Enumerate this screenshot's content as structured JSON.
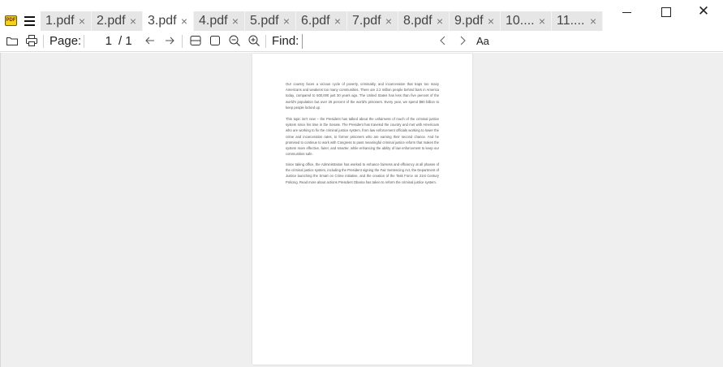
{
  "app": {
    "icon_text": "PDF"
  },
  "tabs": [
    {
      "label": "1.pdf",
      "close": "×",
      "active": false
    },
    {
      "label": "2.pdf",
      "close": "×",
      "active": false
    },
    {
      "label": "3.pdf",
      "close": "×",
      "active": true
    },
    {
      "label": "4.pdf",
      "close": "×",
      "active": false
    },
    {
      "label": "5.pdf",
      "close": "×",
      "active": false
    },
    {
      "label": "6.pdf",
      "close": "×",
      "active": false
    },
    {
      "label": "7.pdf",
      "close": "×",
      "active": false
    },
    {
      "label": "8.pdf",
      "close": "×",
      "active": false
    },
    {
      "label": "9.pdf",
      "close": "×",
      "active": false
    },
    {
      "label": "10....",
      "close": "×",
      "active": false
    },
    {
      "label": "11....",
      "close": "×",
      "active": false
    }
  ],
  "window": {
    "close_glyph": "✕"
  },
  "toolbar": {
    "page_label": "Page:",
    "page_value": "1",
    "page_total": "/ 1",
    "find_label": "Find:",
    "find_value": "",
    "case_label": "Aa"
  },
  "document": {
    "paragraphs": [
      "Our country faces a vicious cycle of poverty, criminality, and incarceration that traps too many Americans and weakens too many communities. There are 2.2 million people behind bars in America today, compared to 500,000 just 30 years ago. The United States has less than five percent of the world's population but over 25 percent of the world's prisoners. Every year, we spend $80 billion to keep people locked up.",
      "This topic isn't new – the President has talked about the unfairness of much of the criminal justice system since his time in the Senate. The President has traveled the country and met with Americans who are working to fix the criminal justice system, from law enforcement officials working to lower the crime and incarceration rates, to former prisoners who are earning their second chance. And he promised to continue to work with Congress to pass meaningful criminal justice reform that makes the system more effective, fairer, and smarter, while enhancing the ability of law enforcement to keep our communities safe.",
      "Since taking office, the Administration has worked to enhance fairness and efficiency at all phases of the criminal justice system, including the President signing the Fair Sentencing Act, the Department of Justice launching the Smart on Crime initiative, and the creation of the Task Force on 21st Century Policing. Read more about actions President Obama has taken to reform the criminal justice system."
    ]
  },
  "colors": {
    "viewer_bg": "#efefef",
    "tab_bg": "#e6e6e6",
    "tab_active_bg": "#ffffff",
    "icon_accent": "#f2d21b"
  }
}
